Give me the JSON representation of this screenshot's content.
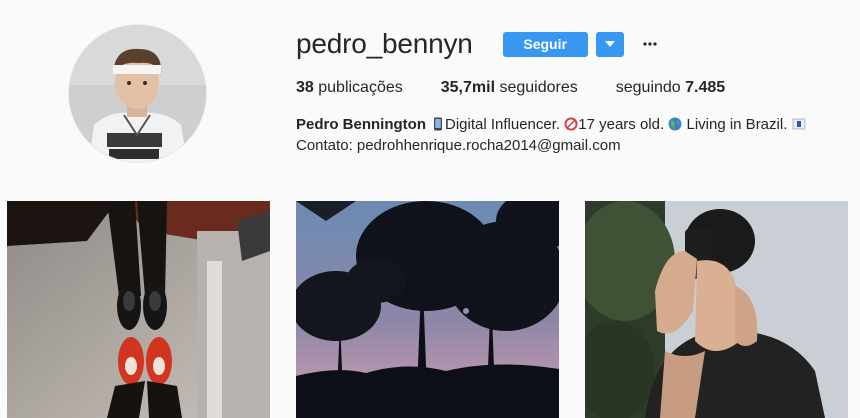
{
  "profile": {
    "username": "pedro_bennyn",
    "follow_label": "Seguir",
    "dropdown_icon": "caret-down-icon",
    "more_icon": "ellipsis-icon",
    "accent_color": "#3897f0"
  },
  "stats": {
    "posts_count": "38",
    "posts_label": "publicações",
    "followers_count": "35,7mil",
    "followers_label": "seguidores",
    "following_label": "seguindo",
    "following_count": "7.485"
  },
  "bio": {
    "full_name": "Pedro Bennington",
    "text_1": "Digital Influencer.",
    "text_2": "17 years old.",
    "text_3": "Living in Brazil.",
    "contact": "Contato: pedrohhenrique.rocha2014@gmail.com",
    "icons": [
      "mobile-phone-emoji",
      "no-under-18-emoji",
      "globe-emoji",
      "flag-emoji"
    ]
  },
  "posts": [
    {
      "icon": "photo-sneakers"
    },
    {
      "icon": "photo-sunset-trees"
    },
    {
      "icon": "photo-selfie-phone"
    }
  ]
}
